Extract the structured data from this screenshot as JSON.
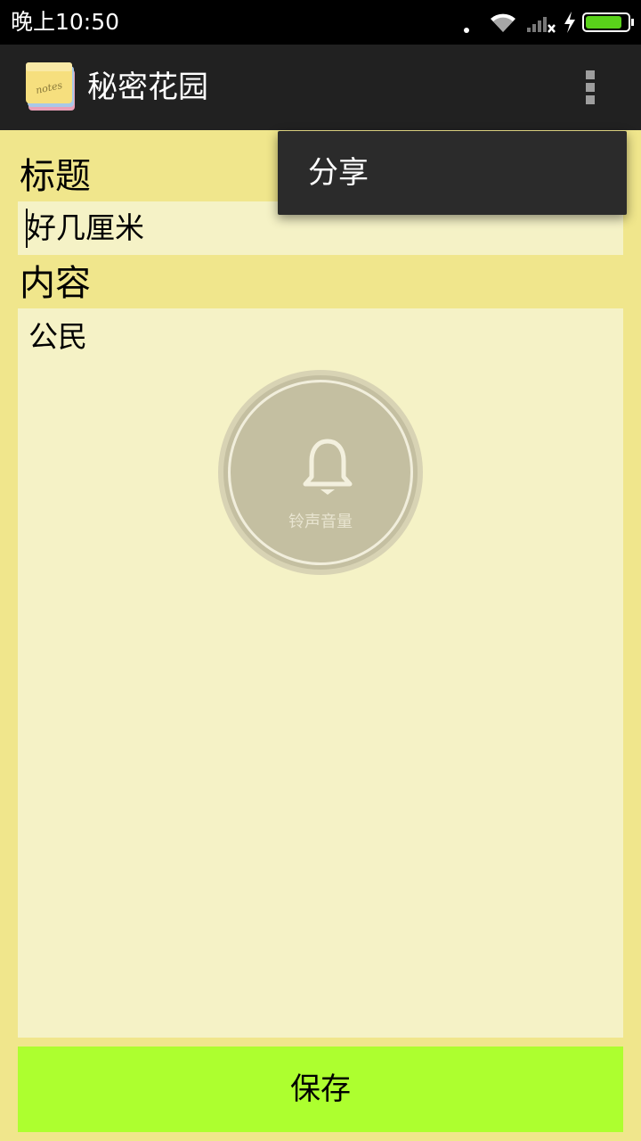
{
  "status_bar": {
    "time": "晚上10:50",
    "icons": [
      "more-dots-icon",
      "wifi-icon",
      "signal-no-sim-icon",
      "charging-icon",
      "battery-icon"
    ],
    "battery_color": "#59d21a"
  },
  "app_bar": {
    "title": "秘密花园",
    "icon": "notes-app-icon",
    "icon_text": "notes",
    "overflow_icon": "overflow-menu-icon"
  },
  "form": {
    "title_label": "标题",
    "title_value": "好几厘米",
    "content_label": "内容",
    "content_value": "公民",
    "save_label": "保存"
  },
  "volume_overlay": {
    "icon": "bell-icon",
    "label": "铃声音量"
  },
  "popup_menu": {
    "items": [
      {
        "label": "分享"
      }
    ]
  },
  "colors": {
    "background": "#f0e68c",
    "field_background": "#f5f2c6",
    "save_button": "#adff2f",
    "app_bar": "#212121",
    "popup": "#2b2b2b"
  }
}
